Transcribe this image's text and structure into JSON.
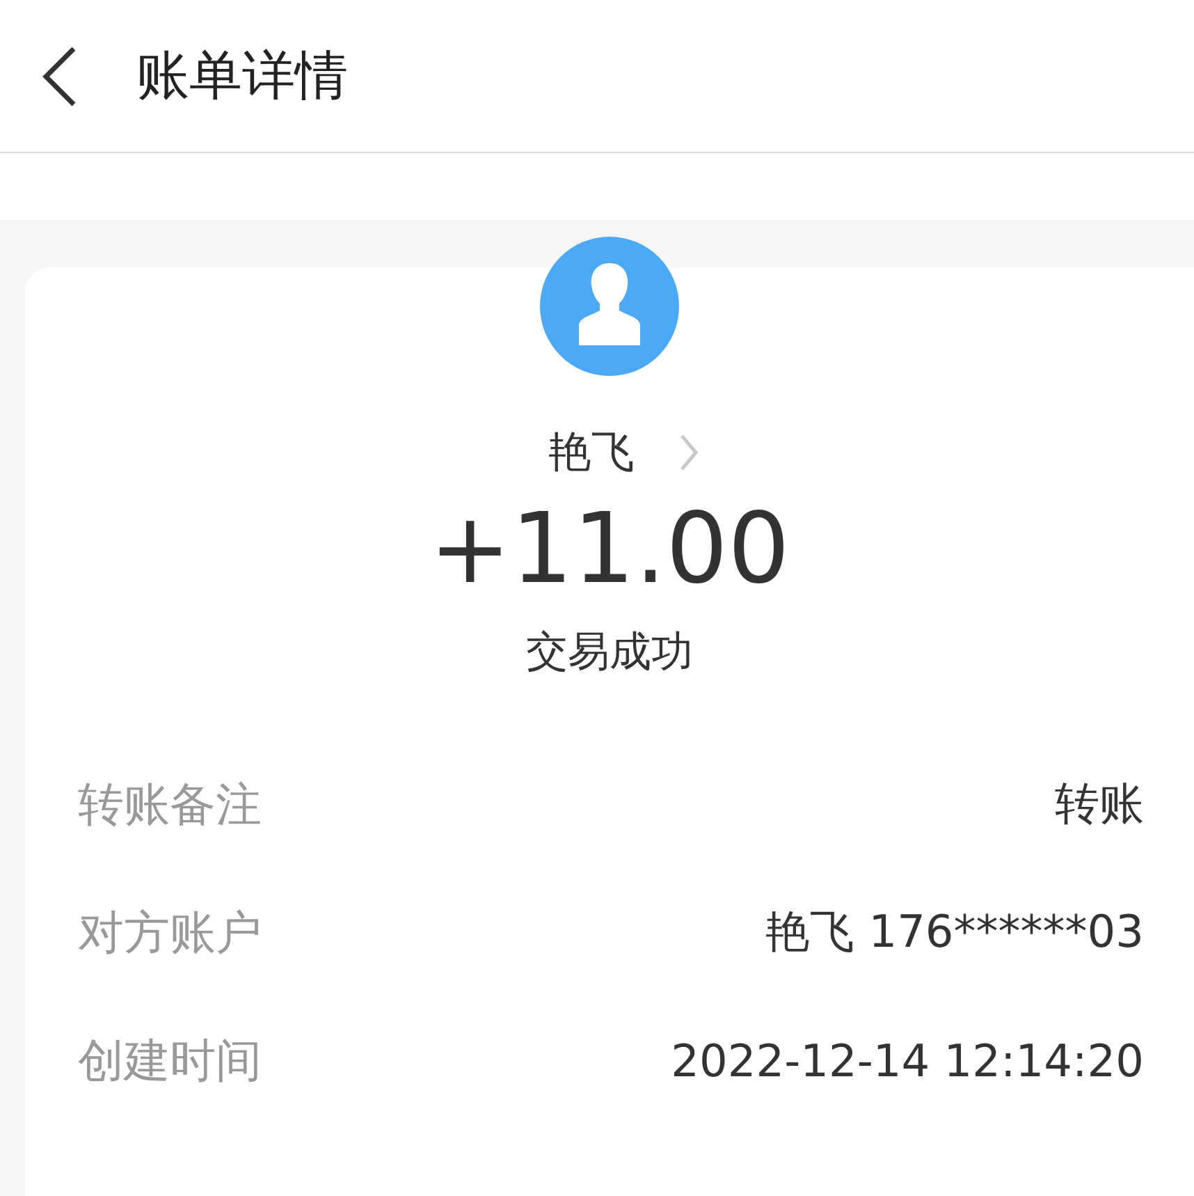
{
  "header": {
    "title": "账单详情"
  },
  "payee": {
    "name": "艳飞",
    "amount": "+11.00",
    "status": "交易成功"
  },
  "details": [
    {
      "label": "转账备注",
      "value": "转账"
    },
    {
      "label": "对方账户",
      "value": "艳飞 176******03"
    },
    {
      "label": "创建时间",
      "value": "2022-12-14 12:14:20"
    }
  ]
}
